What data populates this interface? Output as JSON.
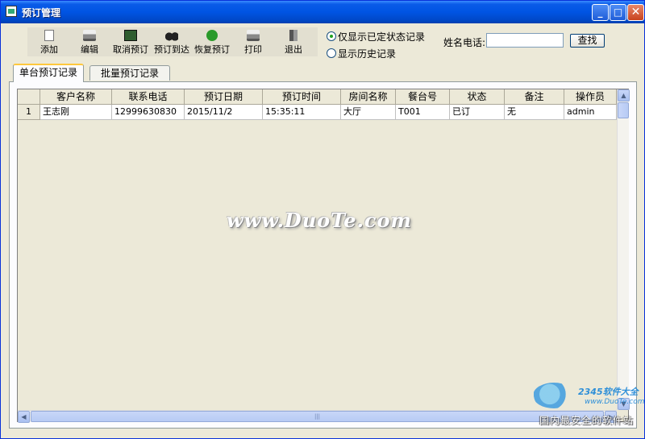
{
  "window": {
    "title": "预订管理",
    "minimize": "_",
    "maximize": "□",
    "close": "✕"
  },
  "toolbar": [
    {
      "label": "添加",
      "icon": "document-icon"
    },
    {
      "label": "编辑",
      "icon": "printer-icon"
    },
    {
      "label": "取消预订",
      "icon": "film-icon"
    },
    {
      "label": "预订到达",
      "icon": "binoculars-icon"
    },
    {
      "label": "恢复预订",
      "icon": "green-arrow-icon"
    },
    {
      "label": "打印",
      "icon": "printer-icon"
    },
    {
      "label": "退出",
      "icon": "exit-door-icon"
    }
  ],
  "filters": {
    "show_current": "仅显示已定状态记录",
    "show_history": "显示历史记录",
    "selected": "show_current"
  },
  "search": {
    "label": "姓名电话:",
    "value": "",
    "button": "查找"
  },
  "tabs": [
    {
      "label": "单台预订记录",
      "active": true
    },
    {
      "label": "批量预订记录",
      "active": false
    }
  ],
  "table": {
    "columns": [
      "客户名称",
      "联系电话",
      "预订日期",
      "预订时间",
      "房间名称",
      "餐台号",
      "状态",
      "备注",
      "操作员"
    ],
    "rows": [
      {
        "num": "1",
        "cells": [
          "王志刚",
          "12999630830",
          "2015/11/2",
          "15:35:11",
          "大厅",
          "T001",
          "已订",
          "无",
          "admin"
        ]
      }
    ]
  },
  "scroll": {
    "grip": "|||"
  },
  "watermarks": {
    "main": "www.DuoTe.com",
    "brand": "2345软件大全",
    "url": "www.DuoTe.com",
    "slogan": "国内最安全的软件站"
  }
}
